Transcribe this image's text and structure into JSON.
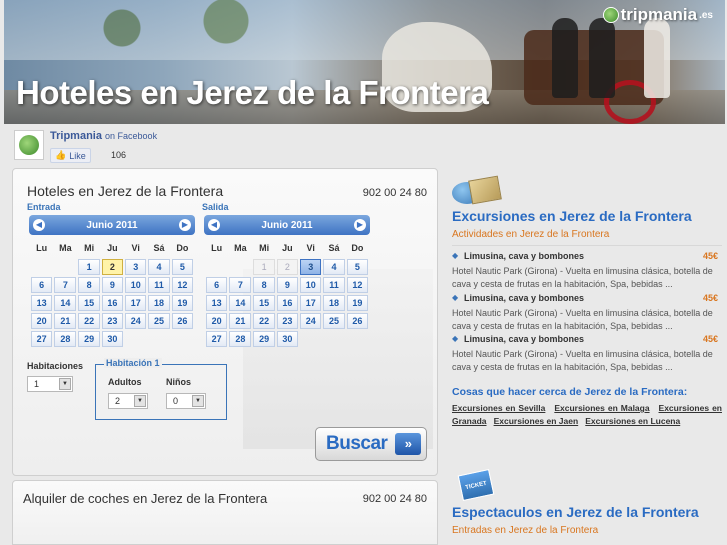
{
  "header": {
    "title": "Hoteles en Jerez de la Frontera",
    "logo_name": "tripmania",
    "logo_tld": ".es"
  },
  "facebook": {
    "page_name": "Tripmania",
    "on_text": "on Facebook",
    "like_label": "Like",
    "like_count": "106"
  },
  "hotels": {
    "title": "Hoteles en Jerez de la Frontera",
    "phone": "902 00 24 80",
    "checkin_label": "Entrada",
    "checkout_label": "Salida",
    "weekdays": [
      "Lu",
      "Ma",
      "Mi",
      "Ju",
      "Vi",
      "Sá",
      "Do"
    ],
    "checkin_calendar": {
      "month": "Junio 2011",
      "weeks": [
        [
          "",
          "",
          "1",
          "2",
          "3",
          "4",
          "5"
        ],
        [
          "6",
          "7",
          "8",
          "9",
          "10",
          "11",
          "12"
        ],
        [
          "13",
          "14",
          "15",
          "16",
          "17",
          "18",
          "19"
        ],
        [
          "20",
          "21",
          "22",
          "23",
          "24",
          "25",
          "26"
        ],
        [
          "27",
          "28",
          "29",
          "30",
          "",
          "",
          ""
        ]
      ],
      "selected": "2"
    },
    "checkout_calendar": {
      "month": "Junio 2011",
      "weeks": [
        [
          "",
          "",
          "1",
          "2",
          "3",
          "4",
          "5"
        ],
        [
          "6",
          "7",
          "8",
          "9",
          "10",
          "11",
          "12"
        ],
        [
          "13",
          "14",
          "15",
          "16",
          "17",
          "18",
          "19"
        ],
        [
          "20",
          "21",
          "22",
          "23",
          "24",
          "25",
          "26"
        ],
        [
          "27",
          "28",
          "29",
          "30",
          "",
          "",
          ""
        ]
      ],
      "selected": "3"
    },
    "rooms_label": "Habitaciones",
    "rooms_value": "1",
    "room_group_title": "Habitación 1",
    "adults_label": "Adultos",
    "adults_value": "2",
    "children_label": "Niños",
    "children_value": "0",
    "search_label": "Buscar"
  },
  "cars": {
    "title": "Alquiler de coches en Jerez de la Frontera",
    "phone": "902 00 24 80"
  },
  "excursions": {
    "title": "Excursiones en Jerez de la Frontera",
    "subtitle": "Actividades en Jerez de la Frontera",
    "items": [
      {
        "name": "Limusina, cava y bombones",
        "price": "45€",
        "desc": "Hotel Nautic Park (Girona) - Vuelta en limusina clásica, botella de cava y cesta de frutas en la habitación, Spa, bebidas ..."
      },
      {
        "name": "Limusina, cava y bombones",
        "price": "45€",
        "desc": "Hotel Nautic Park (Girona) - Vuelta en limusina clásica, botella de cava y cesta de frutas en la habitación, Spa, bebidas ..."
      },
      {
        "name": "Limusina, cava y bombones",
        "price": "45€",
        "desc": "Hotel Nautic Park (Girona) - Vuelta en limusina clásica, botella de cava y cesta de frutas en la habitación, Spa, bebidas ..."
      }
    ],
    "nearby_title": "Cosas que hacer cerca de Jerez de la Frontera:",
    "nearby_links": [
      "Excursiones en Sevilla",
      "Excursiones en Malaga",
      "Excursiones en Granada",
      "Excursiones en Jaen",
      "Excursiones en Lucena"
    ]
  },
  "shows": {
    "title": "Espectaculos en Jerez de la Frontera",
    "subtitle": "Entradas en Jerez de la Frontera",
    "ticket_text": "TICKET"
  },
  "colors": {
    "accent_blue": "#2a6bc2",
    "accent_orange": "#d9761f",
    "facebook_blue": "#3b5998"
  }
}
